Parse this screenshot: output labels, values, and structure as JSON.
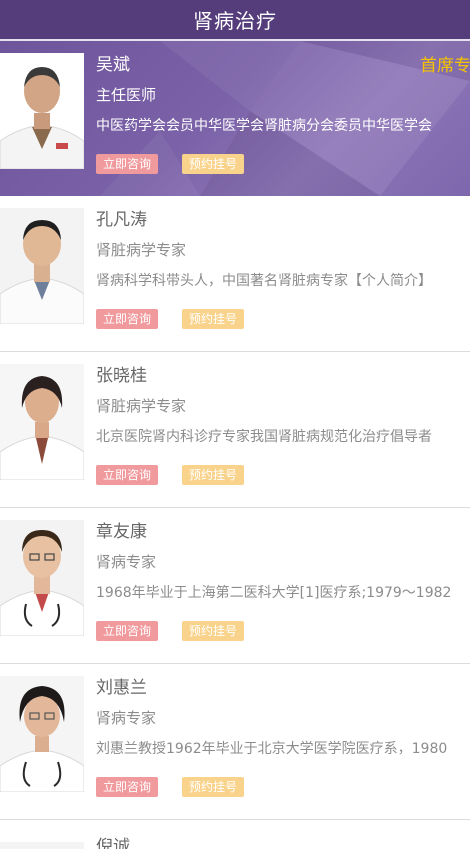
{
  "header": {
    "title": "肾病治疗"
  },
  "buttons": {
    "consult": "立即咨询",
    "book": "预约挂号"
  },
  "doctors": [
    {
      "name": "吴斌",
      "title": "主任医师",
      "intro": "中医药学会会员中华医学会肾脏病分会委员中华医学会",
      "badge": "首席专家",
      "featured": true
    },
    {
      "name": "孔凡涛",
      "title": "肾脏病学专家",
      "intro": "肾病科学科带头人，中国著名肾脏病专家【个人简介】"
    },
    {
      "name": "张晓桂",
      "title": "肾脏病学专家",
      "intro": "北京医院肾内科诊疗专家我国肾脏病规范化治疗倡导者"
    },
    {
      "name": "章友康",
      "title": "肾病专家",
      "intro": "1968年毕业于上海第二医科大学[1]医疗系;1979～1982"
    },
    {
      "name": "刘惠兰",
      "title": "肾病专家",
      "intro": "刘惠兰教授1962年毕业于北京大学医学院医疗系，1980"
    },
    {
      "name": "倪诚"
    }
  ],
  "colors": {
    "header_bg": "#553d7c",
    "featured_bg": "#7b62a8",
    "badge": "#f5c400",
    "consult_btn": "#f09a9d",
    "book_btn": "#f9d38b"
  }
}
